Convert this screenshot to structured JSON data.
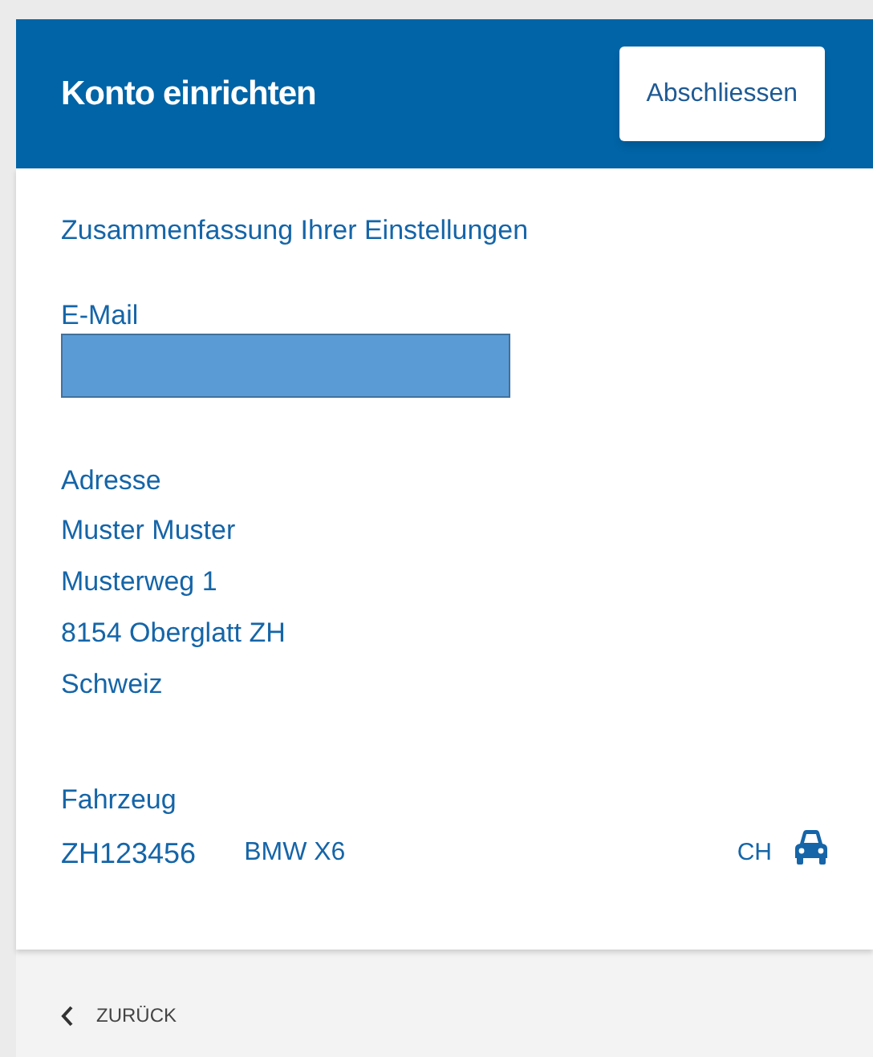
{
  "header": {
    "title": "Konto einrichten",
    "button": "Abschliessen"
  },
  "summary_title": "Zusammenfassung Ihrer Einstellungen",
  "email": {
    "label": "E-Mail"
  },
  "address": {
    "label": "Adresse",
    "lines": [
      "Muster Muster",
      "Musterweg 1",
      "8154 Oberglatt ZH",
      "Schweiz"
    ]
  },
  "vehicle": {
    "label": "Fahrzeug",
    "plate": "ZH123456",
    "model": "BMW X6",
    "country": "CH"
  },
  "footer": {
    "back": "ZURÜCK"
  }
}
